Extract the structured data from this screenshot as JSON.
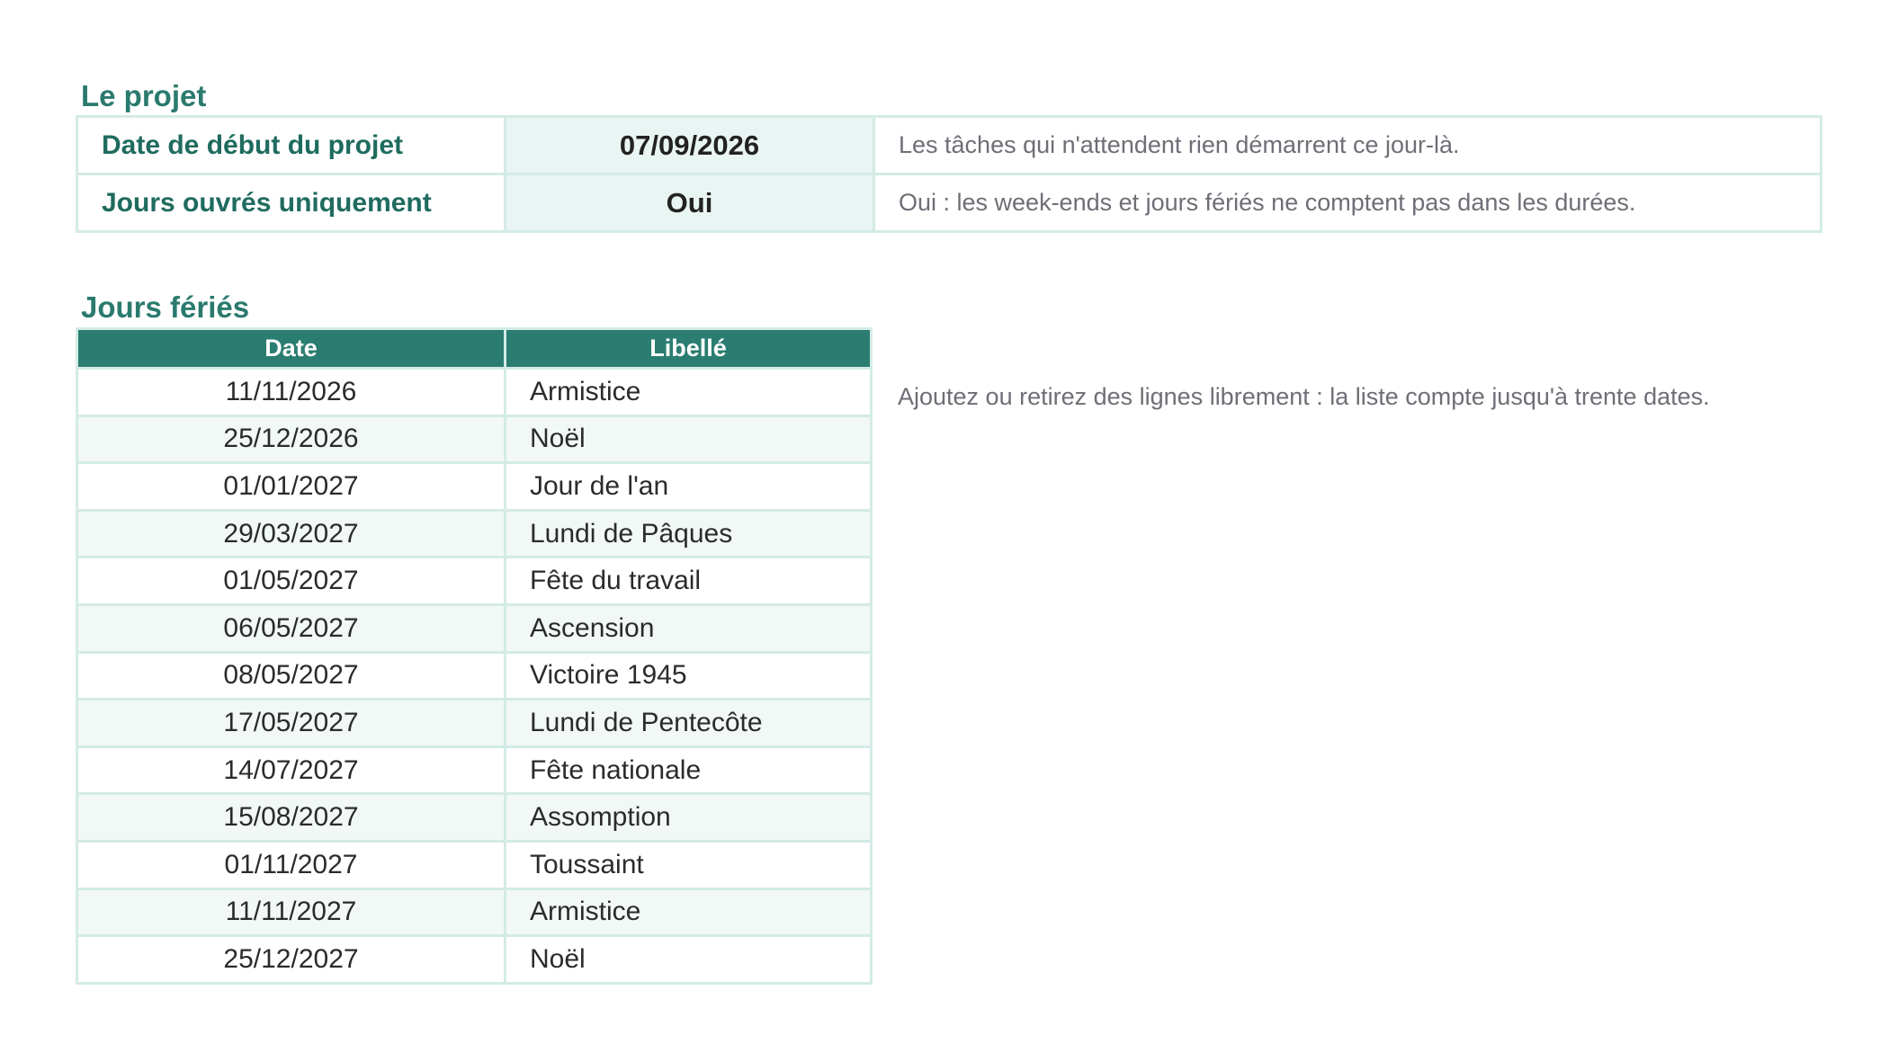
{
  "projet": {
    "title": "Le projet",
    "rows": [
      {
        "label": "Date de début du projet",
        "value": "07/09/2026",
        "note": "Les tâches qui n'attendent rien démarrent ce jour-là."
      },
      {
        "label": "Jours ouvrés uniquement",
        "value": "Oui",
        "note": "Oui : les week-ends et jours fériés ne comptent pas dans les durées."
      }
    ]
  },
  "feries": {
    "title": "Jours fériés",
    "headers": {
      "date": "Date",
      "label": "Libellé"
    },
    "note": "Ajoutez ou retirez des lignes librement : la liste compte jusqu'à trente dates.",
    "rows": [
      {
        "date": "11/11/2026",
        "label": "Armistice"
      },
      {
        "date": "25/12/2026",
        "label": "Noël"
      },
      {
        "date": "01/01/2027",
        "label": "Jour de l'an"
      },
      {
        "date": "29/03/2027",
        "label": "Lundi de Pâques"
      },
      {
        "date": "01/05/2027",
        "label": "Fête du travail"
      },
      {
        "date": "06/05/2027",
        "label": "Ascension"
      },
      {
        "date": "08/05/2027",
        "label": "Victoire 1945"
      },
      {
        "date": "17/05/2027",
        "label": "Lundi de Pentecôte"
      },
      {
        "date": "14/07/2027",
        "label": "Fête nationale"
      },
      {
        "date": "15/08/2027",
        "label": "Assomption"
      },
      {
        "date": "01/11/2027",
        "label": "Toussaint"
      },
      {
        "date": "11/11/2027",
        "label": "Armistice"
      },
      {
        "date": "25/12/2027",
        "label": "Noël"
      }
    ]
  },
  "colors": {
    "accent": "#2b7d71",
    "title": "#2a7a6e",
    "border": "#d4ebe6",
    "value_bg": "#e9f5f2",
    "note": "#6e6e76"
  }
}
